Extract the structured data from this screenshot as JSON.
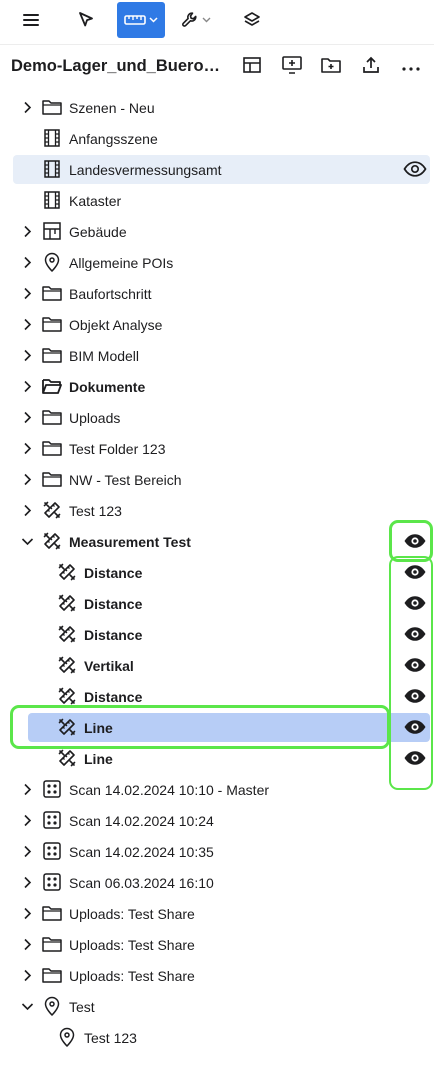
{
  "toolbar": {
    "menu_icon": "hamburger-menu-icon",
    "select_icon": "cursor-arrow-icon",
    "measure_icon": "ruler-icon",
    "tools_icon": "wrench-icon",
    "layers_icon": "layers-icon",
    "accent_color": "#2f7ae5"
  },
  "header": {
    "title": "Demo-Lager_und_Bueroge...",
    "actions": [
      "table-layout-icon",
      "add-screen-icon",
      "add-folder-icon",
      "upload-icon",
      "more-options-icon"
    ]
  },
  "tree": [
    {
      "label": "Szenen - Neu",
      "icon": "folder-icon",
      "chevron": "right",
      "bold": false
    },
    {
      "label": "Anfangsszene",
      "icon": "film-strip-icon",
      "chevron": "none",
      "bold": false
    },
    {
      "label": "Landesvermessungsamt",
      "icon": "film-strip-icon",
      "chevron": "none",
      "bold": false,
      "highlighted": true,
      "visible": true
    },
    {
      "label": "Kataster",
      "icon": "film-strip-icon",
      "chevron": "none",
      "bold": false
    },
    {
      "label": "Gebäude",
      "icon": "building-plan-icon",
      "chevron": "right",
      "bold": false
    },
    {
      "label": "Allgemeine POIs",
      "icon": "map-pin-icon",
      "chevron": "right",
      "bold": false
    },
    {
      "label": "Baufortschritt",
      "icon": "folder-icon",
      "chevron": "right",
      "bold": false
    },
    {
      "label": "Objekt Analyse",
      "icon": "folder-icon",
      "chevron": "right",
      "bold": false
    },
    {
      "label": "BIM Modell",
      "icon": "folder-icon",
      "chevron": "right",
      "bold": false
    },
    {
      "label": "Dokumente",
      "icon": "folder-open-icon",
      "chevron": "right",
      "bold": true
    },
    {
      "label": "Uploads",
      "icon": "folder-icon",
      "chevron": "right",
      "bold": false
    },
    {
      "label": "Test Folder 123",
      "icon": "folder-icon",
      "chevron": "right",
      "bold": false
    },
    {
      "label": "NW - Test Bereich",
      "icon": "folder-icon",
      "chevron": "right",
      "bold": false
    },
    {
      "label": "Test 123",
      "icon": "measure-tools-icon",
      "chevron": "right",
      "bold": false
    },
    {
      "label": "Measurement Test",
      "icon": "measure-tools-icon",
      "chevron": "down",
      "bold": true,
      "visible": true
    },
    {
      "label": "Distance",
      "icon": "measure-tools-icon",
      "chevron": "none",
      "bold": true,
      "child": true,
      "visible": true
    },
    {
      "label": "Distance",
      "icon": "measure-tools-icon",
      "chevron": "none",
      "bold": true,
      "child": true,
      "visible": true
    },
    {
      "label": "Distance",
      "icon": "measure-tools-icon",
      "chevron": "none",
      "bold": true,
      "child": true,
      "visible": true
    },
    {
      "label": "Vertikal",
      "icon": "measure-tools-icon",
      "chevron": "none",
      "bold": true,
      "child": true,
      "visible": true
    },
    {
      "label": "Distance",
      "icon": "measure-tools-icon",
      "chevron": "none",
      "bold": true,
      "child": true,
      "visible": true
    },
    {
      "label": "Line",
      "icon": "measure-tools-icon",
      "chevron": "none",
      "bold": true,
      "child": true,
      "visible": true,
      "selected": true
    },
    {
      "label": "Line",
      "icon": "measure-tools-icon",
      "chevron": "none",
      "bold": true,
      "child": true,
      "visible": true
    },
    {
      "label": "Scan 14.02.2024 10:10 - Master",
      "icon": "point-grid-icon",
      "chevron": "right",
      "bold": false
    },
    {
      "label": "Scan 14.02.2024 10:24",
      "icon": "point-grid-icon",
      "chevron": "right",
      "bold": false
    },
    {
      "label": "Scan 14.02.2024 10:35",
      "icon": "point-grid-icon",
      "chevron": "right",
      "bold": false
    },
    {
      "label": "Scan 06.03.2024 16:10",
      "icon": "point-grid-icon",
      "chevron": "right",
      "bold": false
    },
    {
      "label": "Uploads: Test Share",
      "icon": "folder-icon",
      "chevron": "right",
      "bold": false
    },
    {
      "label": "Uploads: Test Share",
      "icon": "folder-icon",
      "chevron": "right",
      "bold": false
    },
    {
      "label": "Uploads: Test Share",
      "icon": "folder-icon",
      "chevron": "right",
      "bold": false
    },
    {
      "label": "Test",
      "icon": "map-pin-icon",
      "chevron": "down",
      "bold": false
    },
    {
      "label": "Test 123",
      "icon": "map-pin-icon",
      "chevron": "none",
      "bold": false,
      "child": true
    }
  ],
  "colors": {
    "highlight_row": "#e7eef8",
    "selected_row": "#b7cdf6",
    "annotation_outline": "#5be64a",
    "text": "#1d1d1f"
  }
}
